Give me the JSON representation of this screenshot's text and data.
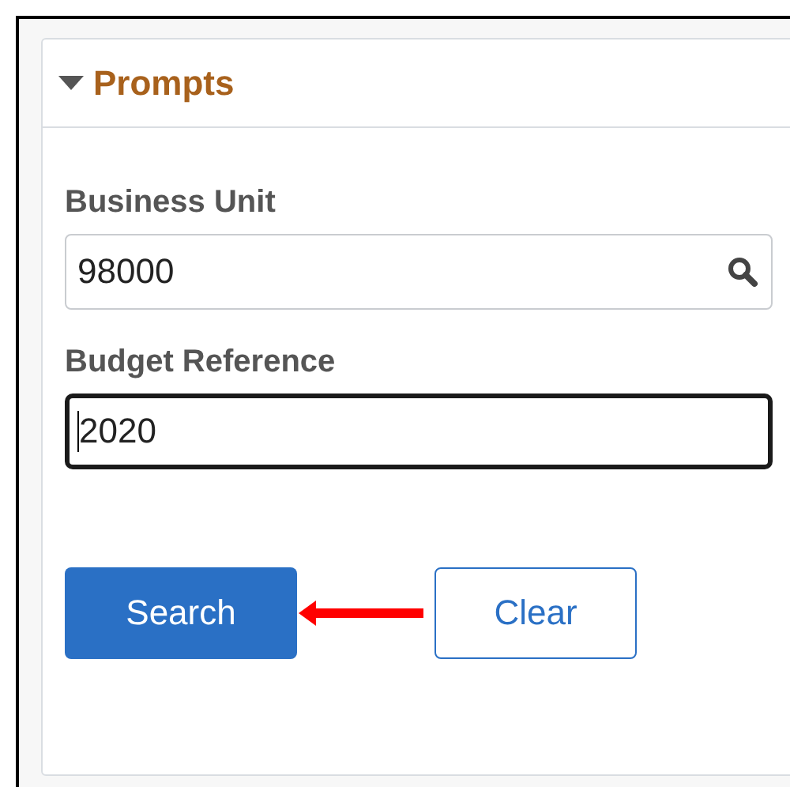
{
  "section": {
    "title": "Prompts",
    "expanded": true
  },
  "fields": [
    {
      "label": "Business Unit",
      "value": "98000",
      "kind": "lookup",
      "focused": false
    },
    {
      "label": "Budget Reference",
      "value": "2020",
      "kind": "text",
      "focused": true
    }
  ],
  "buttons": [
    {
      "label": "Search",
      "kind": "primary"
    },
    {
      "label": "Clear",
      "kind": "secondary"
    }
  ]
}
